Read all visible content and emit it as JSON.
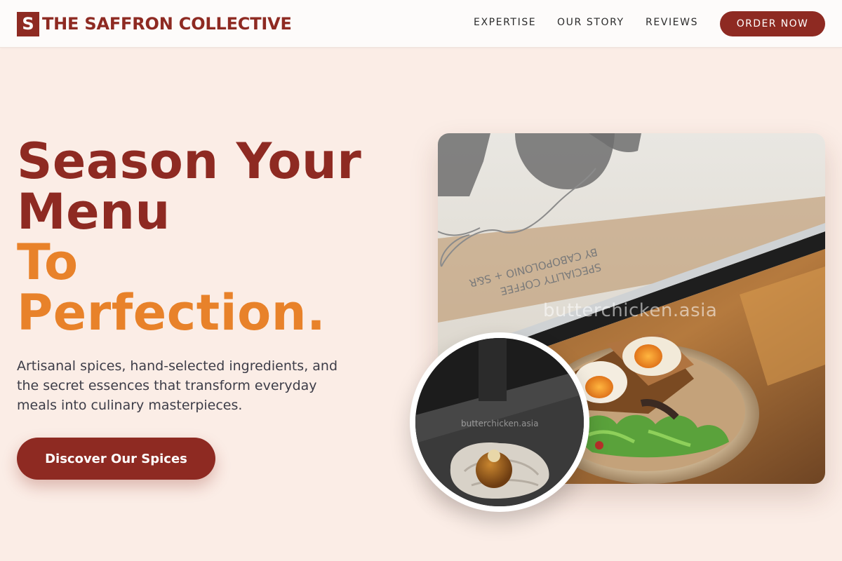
{
  "header": {
    "brand_mark": "S",
    "brand_name": "THE SAFFRON COLLECTIVE",
    "nav": [
      {
        "label": "EXPERTISE"
      },
      {
        "label": "OUR STORY"
      },
      {
        "label": "REVIEWS"
      }
    ],
    "order_button": "ORDER NOW"
  },
  "hero": {
    "title_line1": "Season Your",
    "title_line2": "Menu",
    "title_line3": "To",
    "title_line4": "Perfection.",
    "subtitle": "Artisanal spices, hand-selected ingredients, and the secret essences that transform everyday meals into culinary masterpieces.",
    "cta_label": "Discover Our Spices"
  },
  "images": {
    "main_watermark": "butterchicken.asia",
    "circle_watermark": "butterchicken.asia",
    "window_text_line1": "SPECIALITY COFFEE",
    "window_text_line2": "BY CABOPOLONIO + S&R"
  },
  "colors": {
    "brand": "#8e2a22",
    "accent": "#e8822a",
    "background": "#fbede6",
    "body_text": "#3d3d48"
  }
}
